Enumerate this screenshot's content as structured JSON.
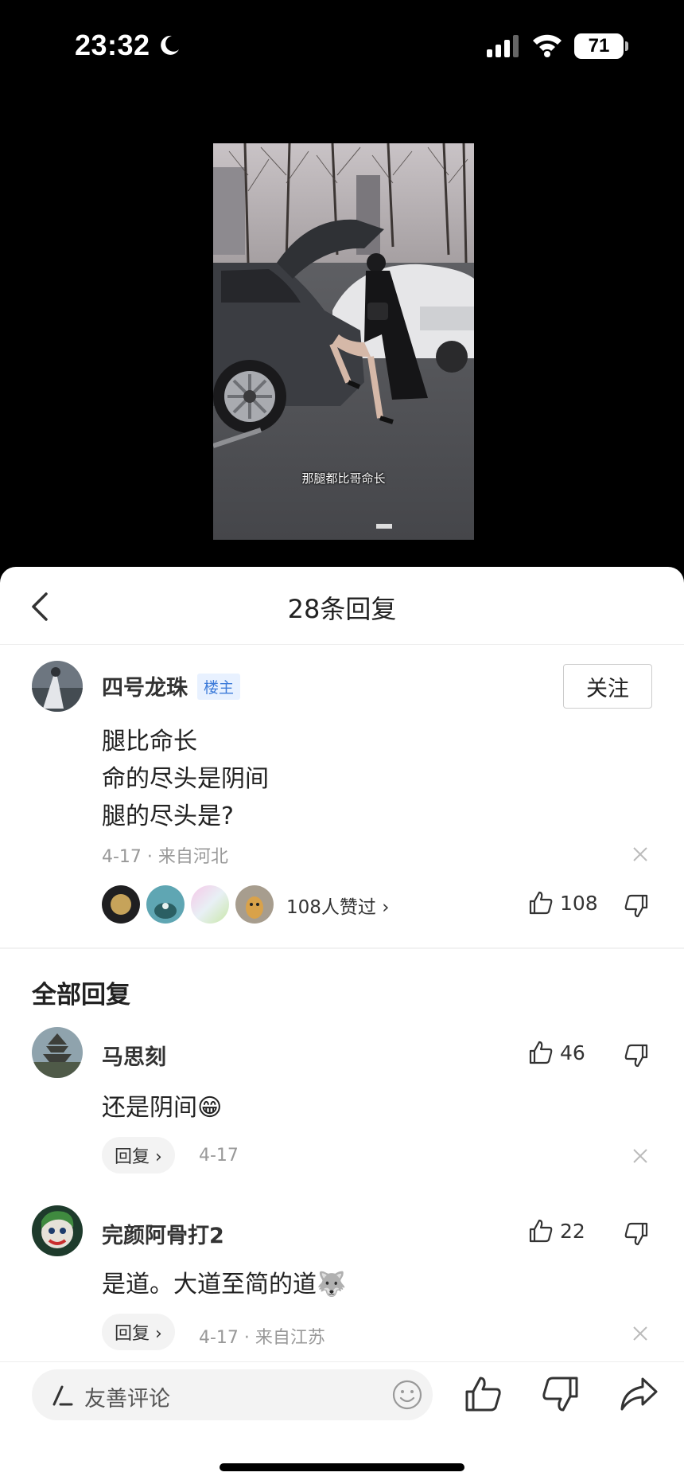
{
  "status_bar": {
    "time": "23:32",
    "battery": "71"
  },
  "video": {
    "subtitle": "那腿都比哥命长"
  },
  "header": {
    "title": "28条回复"
  },
  "main_comment": {
    "user": "四号龙珠",
    "badge": "楼主",
    "follow_label": "关注",
    "lines": [
      "腿比命长",
      "命的尽头是阴间",
      "腿的尽头是?"
    ],
    "meta": "4-17 · 来自河北",
    "likers_text": "108人赞过 ›",
    "like_count": "108"
  },
  "section_title": "全部回复",
  "replies": [
    {
      "user": "马思刻",
      "text": "还是阴间",
      "emoji": "😁",
      "reply_label": "回复 ›",
      "meta": "4-17",
      "like_count": "46"
    },
    {
      "user": "完颜阿骨打2",
      "text": "是道。大道至简的道",
      "emoji": "🐺",
      "reply_label": "回复 ›",
      "meta": "4-17 · 来自江苏",
      "like_count": "22"
    }
  ],
  "bottom_bar": {
    "placeholder": "友善评论"
  }
}
